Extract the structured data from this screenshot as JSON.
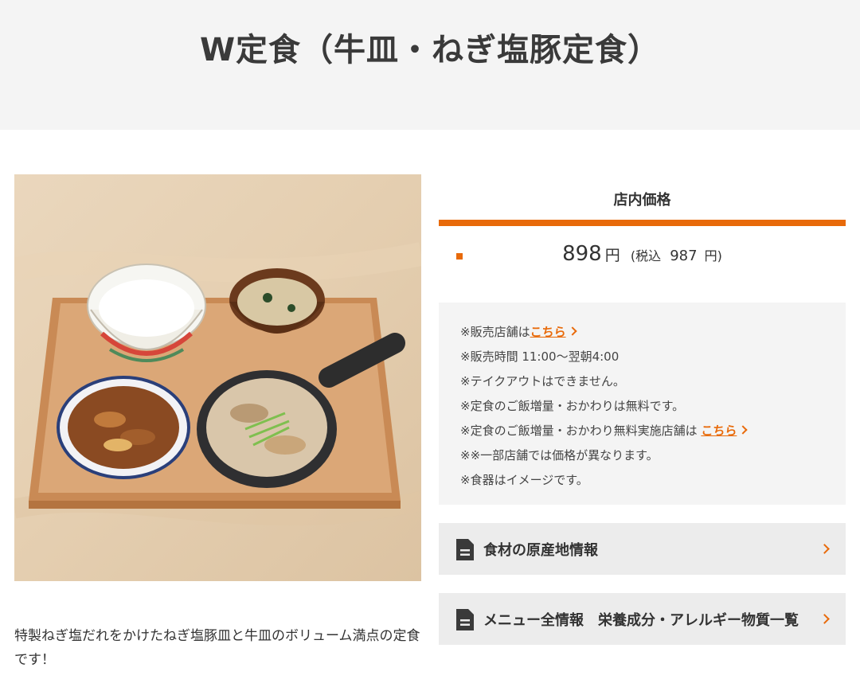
{
  "page": {
    "title": "W定食（牛皿・ねぎ塩豚定食）"
  },
  "product": {
    "image_alt": "W定食（牛皿・ねぎ塩豚定食）",
    "description": "特製ねぎ塩だれをかけたねぎ塩豚皿と牛皿のボリューム満点の定食です！"
  },
  "price": {
    "heading": "店内価格",
    "amount": "898",
    "yen": "円",
    "tax_prefix": "(税込",
    "tax_amount": "987",
    "tax_suffix": "円)"
  },
  "notes": {
    "store_prefix": "※販売店舗は",
    "store_link": "こちら",
    "hours": "※販売時間 11:00〜翌朝4:00",
    "takeout": "※テイクアウトはできません。",
    "refill": "※定食のご飯増量・おかわりは無料です。",
    "refill_store_prefix": "※定食のご飯増量・おかわり無料実施店舗は",
    "refill_store_link": "こちら",
    "price_diff": "※※一部店舗では価格が異なります。",
    "image_note": "※食器はイメージです。"
  },
  "links": [
    {
      "label": "食材の原産地情報",
      "icon": "document-icon"
    },
    {
      "label": "メニュー全情報　栄養成分・アレルギー物質一覧",
      "icon": "document-icon"
    }
  ],
  "colors": {
    "accent": "#e86a0a",
    "header_bg": "#f4f4f4",
    "panel_bg": "#f4f4f4",
    "button_bg": "#ececec"
  }
}
